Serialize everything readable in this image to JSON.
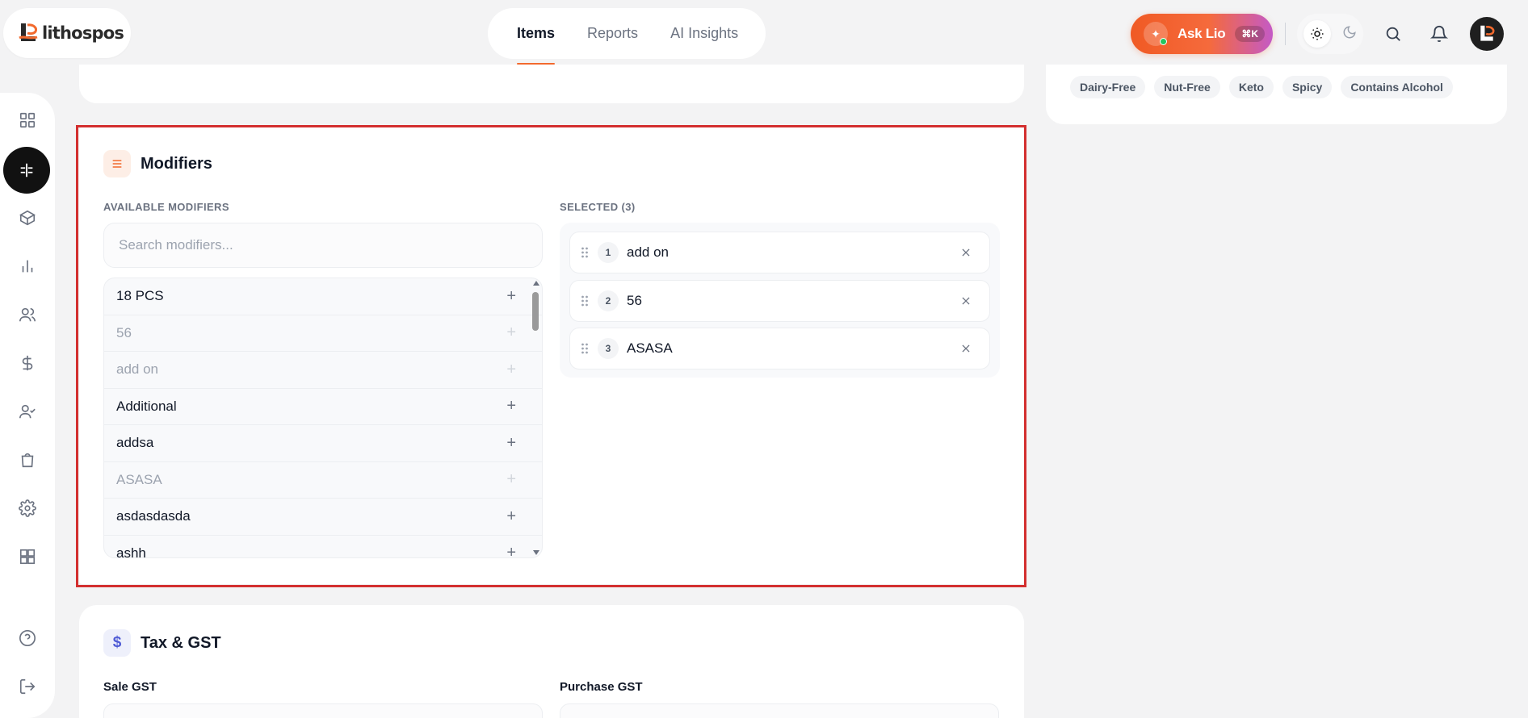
{
  "brand": {
    "name": "lithospos"
  },
  "nav": {
    "tabs": [
      {
        "label": "Items",
        "active": true
      },
      {
        "label": "Reports"
      },
      {
        "label": "AI Insights"
      }
    ]
  },
  "ask": {
    "label": "Ask Lio",
    "shortcut": "⌘K"
  },
  "dietary_tags": [
    "Dairy-Free",
    "Nut-Free",
    "Keto",
    "Spicy",
    "Contains Alcohol"
  ],
  "modifiers": {
    "title": "Modifiers",
    "available_label": "AVAILABLE MODIFIERS",
    "search_placeholder": "Search modifiers...",
    "available": [
      {
        "name": "18 PCS",
        "selected": false
      },
      {
        "name": "56",
        "selected": true
      },
      {
        "name": "add on",
        "selected": true
      },
      {
        "name": "Additional",
        "selected": false
      },
      {
        "name": "addsa",
        "selected": false
      },
      {
        "name": "ASASA",
        "selected": true
      },
      {
        "name": "asdasdasda",
        "selected": false
      },
      {
        "name": "ashh",
        "selected": false
      }
    ],
    "selected_label": "SELECTED (3)",
    "selected": [
      {
        "index": "1",
        "name": "add on"
      },
      {
        "index": "2",
        "name": "56"
      },
      {
        "index": "3",
        "name": "ASASA"
      }
    ]
  },
  "tax": {
    "title": "Tax & GST",
    "icon": "$",
    "sale_label": "Sale GST",
    "purchase_label": "Purchase GST"
  },
  "colors": {
    "accent": "#f26a2e",
    "highlight": "#d32f2f"
  }
}
